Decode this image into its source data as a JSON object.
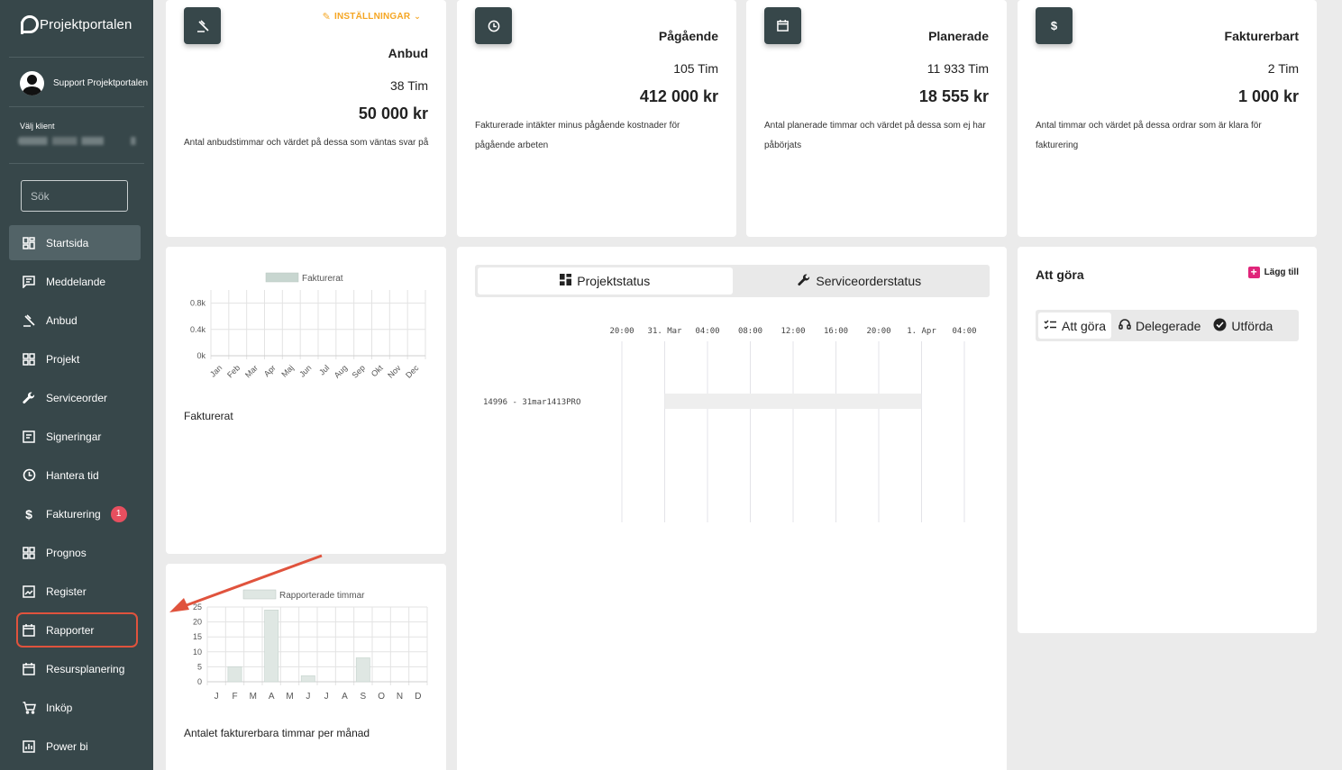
{
  "app": {
    "name": "Projektportalen"
  },
  "user": {
    "name": "Support Projektportalen"
  },
  "client": {
    "label": "Välj klient"
  },
  "search": {
    "placeholder": "Sök"
  },
  "nav": [
    {
      "label": "Startsida",
      "icon": "dashboard-icon"
    },
    {
      "label": "Meddelande",
      "icon": "message-icon"
    },
    {
      "label": "Anbud",
      "icon": "gavel-icon"
    },
    {
      "label": "Projekt",
      "icon": "grid-icon"
    },
    {
      "label": "Serviceorder",
      "icon": "wrench-icon"
    },
    {
      "label": "Signeringar",
      "icon": "signature-icon"
    },
    {
      "label": "Hantera tid",
      "icon": "clock-icon"
    },
    {
      "label": "Fakturering",
      "icon": "dollar-icon",
      "badge": "1"
    },
    {
      "label": "Prognos",
      "icon": "grid-icon"
    },
    {
      "label": "Register",
      "icon": "image-icon"
    },
    {
      "label": "Rapporter",
      "icon": "calendar-icon"
    },
    {
      "label": "Resursplanering",
      "icon": "calendar-icon"
    },
    {
      "label": "Inköp",
      "icon": "cart-icon"
    },
    {
      "label": "Power bi",
      "icon": "chart-icon"
    }
  ],
  "stats": {
    "settings_label": "INSTÄLLNINGAR",
    "anbud": {
      "title": "Anbud",
      "hours": "38 Tim",
      "value": "50 000 kr",
      "desc": "Antal anbudstimmar och värdet på dessa som väntas svar på"
    },
    "pagaende": {
      "title": "Pågående",
      "hours": "105 Tim",
      "value": "412 000 kr",
      "desc": "Fakturerade intäkter minus pågående kostnader för pågående arbeten"
    },
    "planerade": {
      "title": "Planerade",
      "hours": "11 933 Tim",
      "value": "18 555 kr",
      "desc": "Antal planerade timmar och värdet på dessa som ej har påbörjats"
    },
    "fakturerbart": {
      "title": "Fakturerbart",
      "hours": "2 Tim",
      "value": "1 000 kr",
      "desc": "Antal timmar och värdet på dessa ordrar som är klara för fakturering"
    }
  },
  "invoiced_chart": {
    "caption": "Fakturerat"
  },
  "hours_chart": {
    "caption": "Antalet fakturerbara timmar per månad"
  },
  "chart_data": [
    {
      "type": "bar",
      "categories": [
        "Jan",
        "Feb",
        "Mar",
        "Apr",
        "Maj",
        "Jun",
        "Jul",
        "Aug",
        "Sep",
        "Okt",
        "Nov",
        "Dec"
      ],
      "series": [
        {
          "name": "Fakturerat",
          "values": [
            0,
            0,
            0,
            0,
            0,
            0,
            0,
            0,
            0,
            0,
            0,
            0
          ]
        }
      ],
      "yticks": [
        "0k",
        "0.4k",
        "0.8k"
      ],
      "ylim": [
        0,
        1000
      ],
      "grid": true,
      "legend": "top",
      "color": "#c8d6d0"
    },
    {
      "type": "bar",
      "categories": [
        "J",
        "F",
        "M",
        "A",
        "M",
        "J",
        "J",
        "A",
        "S",
        "O",
        "N",
        "D"
      ],
      "series": [
        {
          "name": "Rapporterade timmar",
          "values": [
            0,
            5,
            0,
            24,
            0,
            2,
            0,
            0,
            8,
            0,
            0,
            0
          ]
        }
      ],
      "yticks": [
        "0",
        "5",
        "10",
        "15",
        "20",
        "25"
      ],
      "ylim": [
        0,
        25
      ],
      "grid": true,
      "legend": "top",
      "color": "#dfe7e3"
    }
  ],
  "status_tabs": [
    {
      "label": "Projektstatus",
      "icon": "dashboard-icon"
    },
    {
      "label": "Serviceorderstatus",
      "icon": "wrench-icon"
    }
  ],
  "gantt": {
    "time_labels": [
      "20:00",
      "31. Mar",
      "04:00",
      "08:00",
      "12:00",
      "16:00",
      "20:00",
      "1. Apr",
      "04:00"
    ],
    "rows": [
      {
        "label": "14996 - 31mar1413PRO",
        "start_slot": 1,
        "end_slot": 7
      }
    ]
  },
  "todo": {
    "title": "Att göra",
    "add_label": "Lägg till",
    "tabs": [
      {
        "label": "Att göra",
        "icon": "checklist-icon"
      },
      {
        "label": "Delegerade",
        "icon": "headset-icon"
      },
      {
        "label": "Utförda",
        "icon": "check-circle-icon"
      }
    ]
  }
}
